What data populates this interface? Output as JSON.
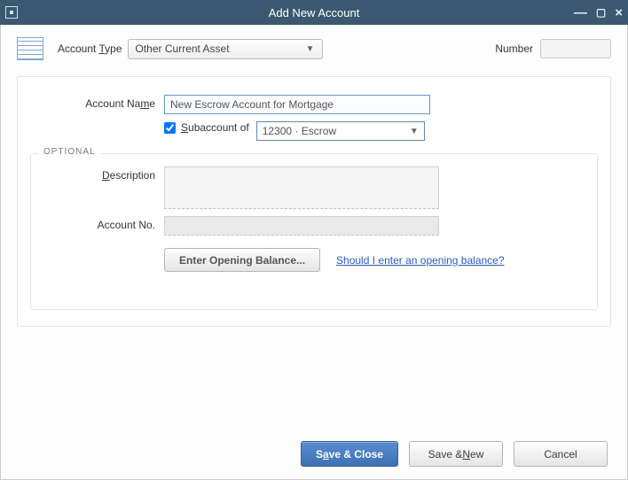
{
  "window": {
    "title": "Add New Account"
  },
  "top": {
    "account_type_label_pre": "Account ",
    "account_type_label_u": "T",
    "account_type_label_post": "ype",
    "account_type_value": "Other Current Asset",
    "number_label": "Number"
  },
  "name_row": {
    "label_pre": "Account Na",
    "label_u": "m",
    "label_post": "e",
    "value": "New Escrow Account for Mortgage"
  },
  "sub_row": {
    "label_u": "S",
    "label_post": "ubaccount of",
    "value": "12300 · Escrow",
    "checked": true
  },
  "optional": {
    "legend": "OPTIONAL",
    "desc_label_u": "D",
    "desc_label_post": "escription",
    "desc_value": "",
    "acct_no_label": "Account No.",
    "acct_no_value": "",
    "opening_btn": "Enter Opening Balance...",
    "opening_link": "Should I enter an opening balance?"
  },
  "footer": {
    "save_close_pre": "S",
    "save_close_u": "a",
    "save_close_post": "ve & Close",
    "save_new_pre": "Save & ",
    "save_new_u": "N",
    "save_new_post": "ew",
    "cancel": "Cancel"
  }
}
